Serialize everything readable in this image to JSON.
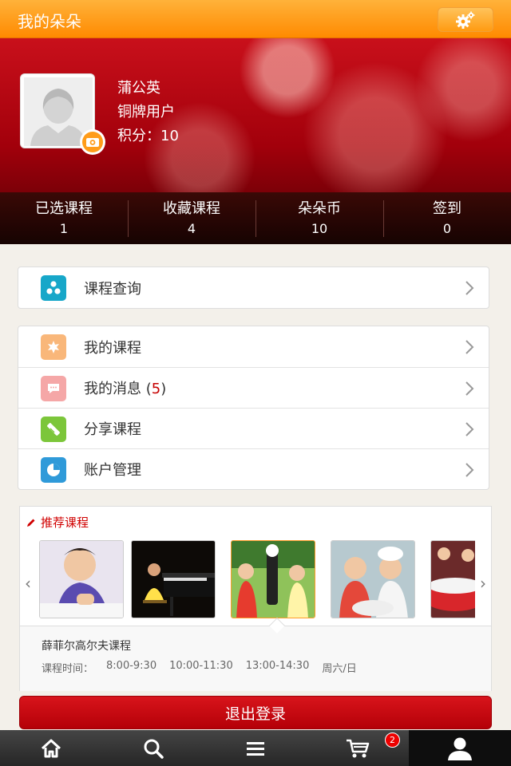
{
  "header": {
    "title": "我的朵朵",
    "settings_icon": "gear-icon"
  },
  "profile": {
    "name": "蒲公英",
    "level": "铜牌用户",
    "points": "积分：10"
  },
  "stats": [
    {
      "label": "已选课程",
      "value": "1"
    },
    {
      "label": "收藏课程",
      "value": "4"
    },
    {
      "label": "朵朵币",
      "value": "10"
    },
    {
      "label": "签到",
      "value": "0"
    }
  ],
  "menu_group1": [
    {
      "label": "课程查询",
      "icon": "course-search-icon",
      "color": "#17a7c9"
    }
  ],
  "menu_group2": [
    {
      "label": "我的课程",
      "icon": "my-courses-icon",
      "color": "#f9b77a"
    },
    {
      "label": "我的消息 (",
      "count": "5",
      "suffix": ")",
      "icon": "messages-icon",
      "color": "#f5a7a7"
    },
    {
      "label": "分享课程",
      "icon": "share-icon",
      "color": "#7cc63a"
    },
    {
      "label": "账户管理",
      "icon": "account-icon",
      "color": "#2f9ad9"
    }
  ],
  "recommend": {
    "title": "推荐课程",
    "course_name": "薛菲尔高尔夫课程",
    "time_label": "课程时间：",
    "times": [
      "8:00-9:30",
      "10:00-11:30",
      "13:00-14:30",
      "周六/日"
    ]
  },
  "logout_label": "退出登录",
  "cart_badge": "2",
  "colors": {
    "accent": "#ff8a00",
    "brand_red": "#c60000"
  }
}
